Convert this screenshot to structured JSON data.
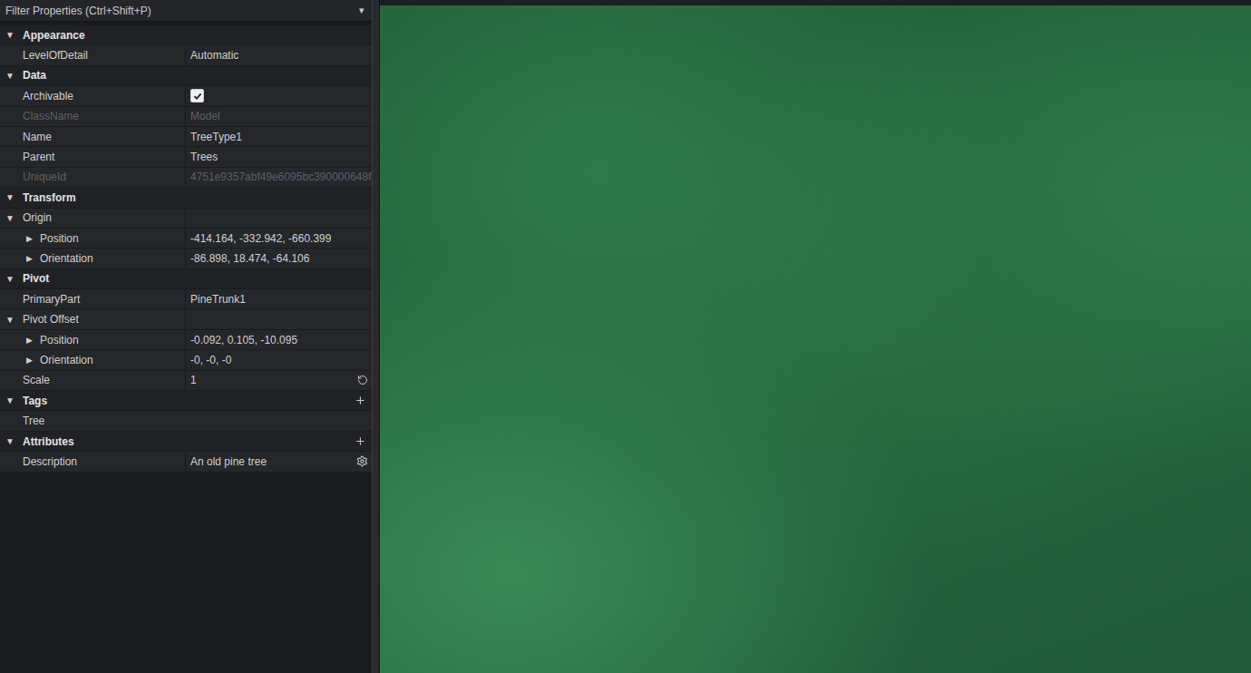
{
  "filter": {
    "placeholder": "Filter Properties (Ctrl+Shift+P)",
    "menu_toggle": "▾"
  },
  "sections": [
    {
      "title": "Appearance",
      "toggle": "▼",
      "expanded": true,
      "add_button": false,
      "rows": [
        {
          "kind": "property",
          "label": "LevelOfDetail",
          "value": "Automatic",
          "disabled": false
        }
      ]
    },
    {
      "title": "Data",
      "toggle": "▼",
      "expanded": true,
      "add_button": false,
      "rows": [
        {
          "kind": "checkbox",
          "label": "Archivable",
          "checked": true,
          "disabled": false
        },
        {
          "kind": "property",
          "label": "ClassName",
          "value": "Model",
          "disabled": true
        },
        {
          "kind": "property",
          "label": "Name",
          "value": "TreeType1",
          "disabled": false
        },
        {
          "kind": "property",
          "label": "Parent",
          "value": "Trees",
          "disabled": false
        },
        {
          "kind": "property",
          "label": "UniqueId",
          "value": "4751e9357abf49e6095bc390000648f",
          "disabled": true
        }
      ]
    },
    {
      "title": "Transform",
      "toggle": "▼",
      "expanded": true,
      "add_button": false,
      "rows": [
        {
          "kind": "group",
          "label": "Origin",
          "toggle": "▼",
          "expanded": true,
          "disabled": false
        },
        {
          "kind": "subproperty",
          "label": "Position",
          "toggle": "▶",
          "expanded": false,
          "value": "-414.164, -332.942, -660.399",
          "disabled": false
        },
        {
          "kind": "subproperty",
          "label": "Orientation",
          "toggle": "▶",
          "expanded": false,
          "value": "-86.898, 18.474, -64.106",
          "disabled": false
        }
      ]
    },
    {
      "title": "Pivot",
      "toggle": "▼",
      "expanded": true,
      "add_button": false,
      "rows": [
        {
          "kind": "property",
          "label": "PrimaryPart",
          "value": "PineTrunk1",
          "disabled": false
        },
        {
          "kind": "group",
          "label": "Pivot Offset",
          "toggle": "▼",
          "expanded": true,
          "disabled": false
        },
        {
          "kind": "subproperty",
          "label": "Position",
          "toggle": "▶",
          "expanded": false,
          "value": "-0.092, 0.105, -10.095",
          "disabled": false
        },
        {
          "kind": "subproperty",
          "label": "Orientation",
          "toggle": "▶",
          "expanded": false,
          "value": "-0, -0, -0",
          "disabled": false
        },
        {
          "kind": "property",
          "label": "Scale",
          "value": "1",
          "disabled": false,
          "reset_button": true
        }
      ]
    },
    {
      "title": "Tags",
      "toggle": "▼",
      "expanded": true,
      "add_button": true,
      "rows": [
        {
          "kind": "tag",
          "label": "Tree",
          "disabled": false
        }
      ]
    },
    {
      "title": "Attributes",
      "toggle": "▼",
      "expanded": true,
      "add_button": true,
      "rows": [
        {
          "kind": "property",
          "label": "Description",
          "value": "An old pine tree",
          "disabled": false,
          "settings_button": true
        }
      ]
    }
  ],
  "viewport": {
    "kind": "3d-scene"
  }
}
